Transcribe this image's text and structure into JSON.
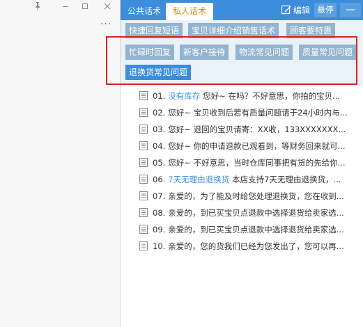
{
  "window_controls": {
    "pin_icon": "pin-icon",
    "restore_icon": "restore-icon",
    "close_icon": "close-icon"
  },
  "left_pane": {
    "more_label": "···"
  },
  "header": {
    "tabs": [
      {
        "label": "公共话术"
      },
      {
        "label": "私人话术"
      }
    ],
    "edit_label": "编辑",
    "hang_label": "悬停",
    "min_label": "—"
  },
  "quick_buttons": [
    {
      "label": "快捷回复短语"
    },
    {
      "label": "宝贝详细介绍销售话术"
    },
    {
      "label": "顾客要特惠"
    },
    {
      "label": "忙碌时回复"
    },
    {
      "label": "新客户接待"
    },
    {
      "label": "物流常见问题"
    },
    {
      "label": "质量常见问题"
    },
    {
      "label": "退换货常见问题"
    }
  ],
  "list": [
    {
      "num": "01.",
      "keyword": "没有库存",
      "text": "您好~ 在吗？不好意思，你拍的宝贝..."
    },
    {
      "num": "02.",
      "keyword": "",
      "text": "您好~ 宝贝收到后若有质量问题请于24小时内与..."
    },
    {
      "num": "03.",
      "keyword": "",
      "text": "您好~ 退回的宝贝请寄：XX收，133XXXXXXX..."
    },
    {
      "num": "04.",
      "keyword": "",
      "text": "您好~ 你的申请退款已观看到，等财务回来就可..."
    },
    {
      "num": "05.",
      "keyword": "",
      "text": "您好~ 不好意思，当时仓库同事把有货的先给你..."
    },
    {
      "num": "06.",
      "keyword": "7天无理由退换货",
      "text": "本店支持7天无理由退换货，..."
    },
    {
      "num": "07.",
      "keyword": "",
      "text": "亲爱的，为了能及时给您处理退换货，您在收到..."
    },
    {
      "num": "08.",
      "keyword": "",
      "text": "亲爱的，到已买宝贝点退款中选择退货给卖家选..."
    },
    {
      "num": "09.",
      "keyword": "",
      "text": "亲爱的，到已买宝贝点退款中选择退货给卖家选..."
    },
    {
      "num": "10.",
      "keyword": "",
      "text": "亲爱的，您的货我们已经为您发出了，您可以再..."
    }
  ],
  "colors": {
    "accent": "#3c8ddb",
    "active_tab_text": "#e38a17",
    "button_inactive": "#92b4d1",
    "highlight_box": "#e02020"
  }
}
